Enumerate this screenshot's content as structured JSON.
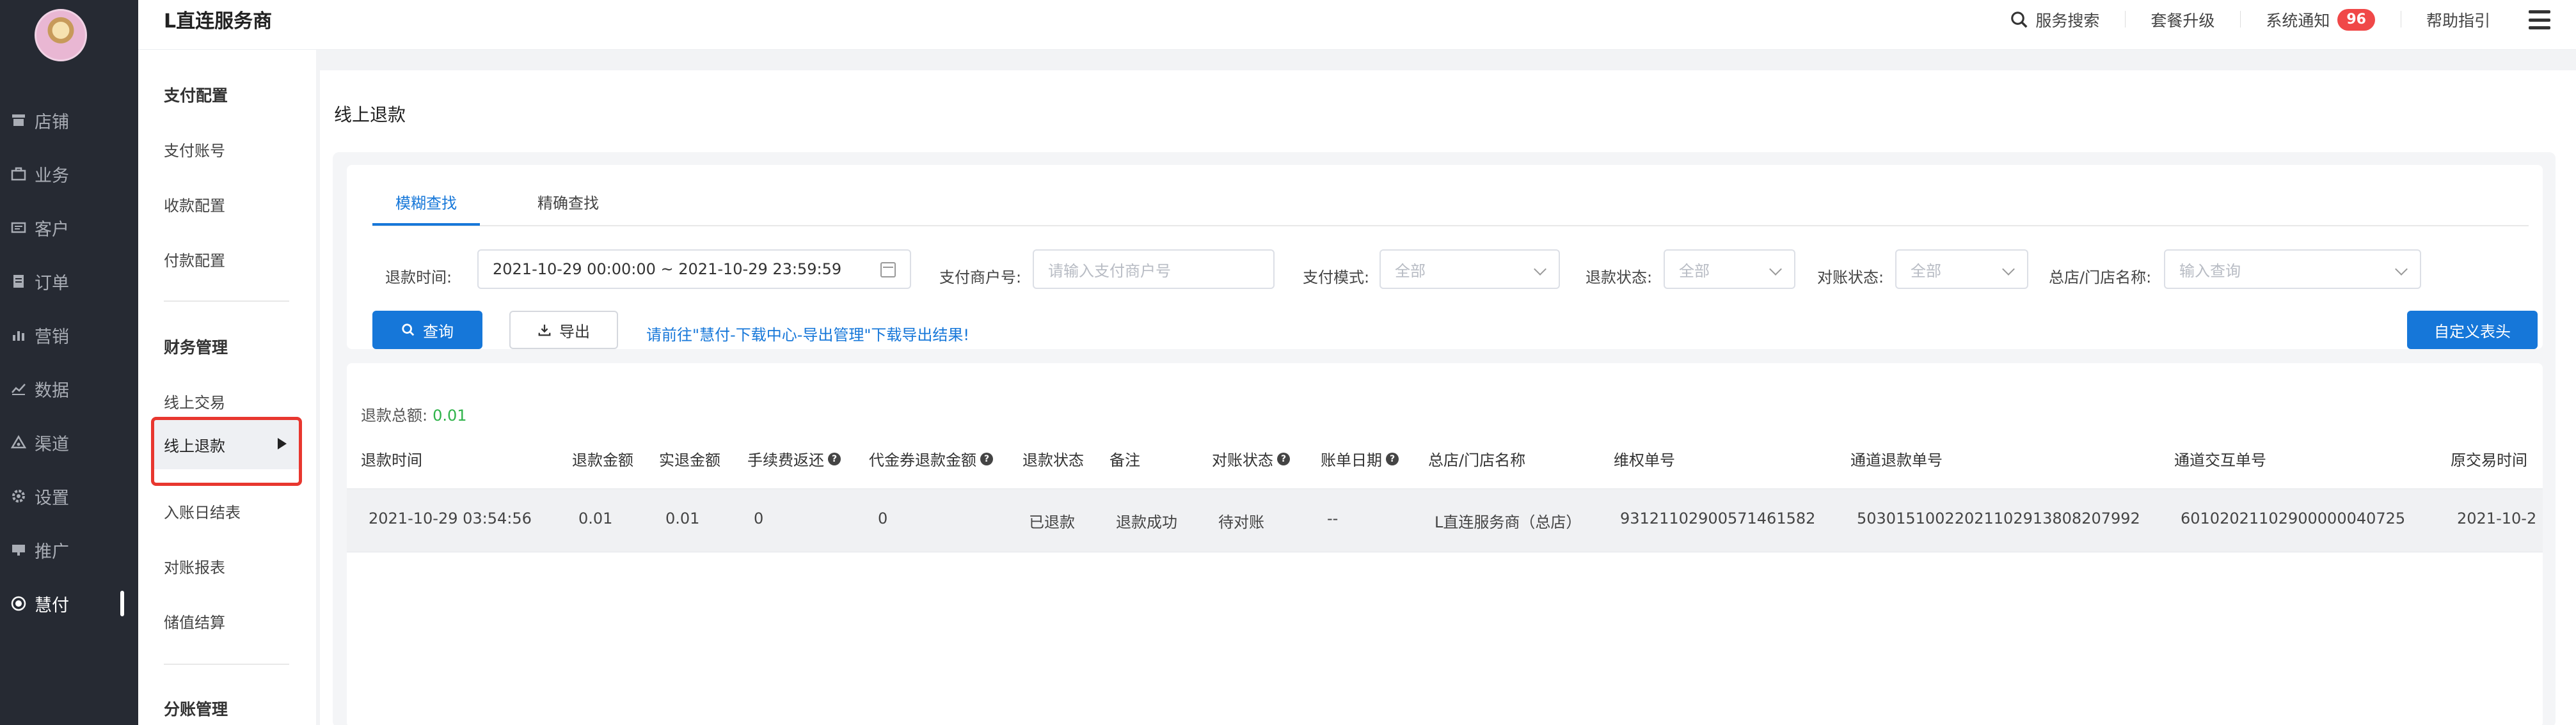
{
  "app": {
    "brand": "L直连服务商"
  },
  "topbar": {
    "search_label": "服务搜索",
    "upgrade_label": "套餐升级",
    "notice_label": "系统通知",
    "notice_count": "96",
    "help_label": "帮助指引"
  },
  "nav": {
    "items": [
      {
        "label": "店铺",
        "icon": "shop-icon"
      },
      {
        "label": "业务",
        "icon": "briefcase-icon"
      },
      {
        "label": "客户",
        "icon": "customer-icon"
      },
      {
        "label": "订单",
        "icon": "order-icon"
      },
      {
        "label": "营销",
        "icon": "marketing-icon"
      },
      {
        "label": "数据",
        "icon": "chart-icon"
      },
      {
        "label": "渠道",
        "icon": "channel-icon"
      },
      {
        "label": "设置",
        "icon": "gear-icon"
      },
      {
        "label": "推广",
        "icon": "promote-icon"
      },
      {
        "label": "慧付",
        "icon": "pay-icon"
      }
    ],
    "active_index": 9
  },
  "subnav": {
    "groups": [
      {
        "title": "支付配置",
        "items": [
          "支付账号",
          "收款配置",
          "付款配置"
        ]
      },
      {
        "title": "财务管理",
        "items": [
          "线上交易",
          "线上退款",
          "入账日结表",
          "对账报表",
          "储值结算"
        ]
      },
      {
        "title": "分账管理",
        "items": []
      }
    ],
    "active_item": "线上退款"
  },
  "page": {
    "title": "线上退款"
  },
  "filters": {
    "tabs": [
      "模糊查找",
      "精确查找"
    ],
    "active_tab": 0,
    "refund_time_label": "退款时间:",
    "refund_time_value": "2021-10-29 00:00:00 ~ 2021-10-29 23:59:59",
    "merchant_label": "支付商户号:",
    "merchant_placeholder": "请输入支付商户号",
    "pay_mode_label": "支付模式:",
    "pay_mode_value": "全部",
    "refund_status_label": "退款状态:",
    "refund_status_value": "全部",
    "recon_status_label": "对账状态:",
    "recon_status_value": "全部",
    "store_label": "总店/门店名称:",
    "store_placeholder": "输入查询",
    "query_button": "查询",
    "export_button": "导出",
    "export_hint": "请前往\"慧付-下载中心-导出管理\"下载导出结果!",
    "custom_header_button": "自定义表头"
  },
  "table": {
    "total_label": "退款总额:",
    "total_value": "0.01",
    "columns": [
      {
        "label": "退款时间",
        "help": false
      },
      {
        "label": "退款金额",
        "help": false
      },
      {
        "label": "实退金额",
        "help": false
      },
      {
        "label": "手续费返还",
        "help": true
      },
      {
        "label": "代金券退款金额",
        "help": true
      },
      {
        "label": "退款状态",
        "help": false
      },
      {
        "label": "备注",
        "help": false
      },
      {
        "label": "对账状态",
        "help": true
      },
      {
        "label": "账单日期",
        "help": true
      },
      {
        "label": "总店/门店名称",
        "help": false
      },
      {
        "label": "维权单号",
        "help": false
      },
      {
        "label": "通道退款单号",
        "help": false
      },
      {
        "label": "通道交互单号",
        "help": false
      },
      {
        "label": "原交易时间",
        "help": false
      }
    ],
    "rows": [
      [
        "2021-10-29 03:54:56",
        "0.01",
        "0.01",
        "0",
        "0",
        "已退款",
        "退款成功",
        "待对账",
        "--",
        "L直连服务商（总店）",
        "93121102900571461582",
        "50301510022021102913808207992",
        "60102021102900000040725",
        "2021-10-2"
      ]
    ]
  },
  "colors": {
    "nav_bg": "#262a33",
    "accent": "#1677d9",
    "badge": "#f04848",
    "highlight": "#e8372f",
    "amount": "#2fb34a"
  }
}
